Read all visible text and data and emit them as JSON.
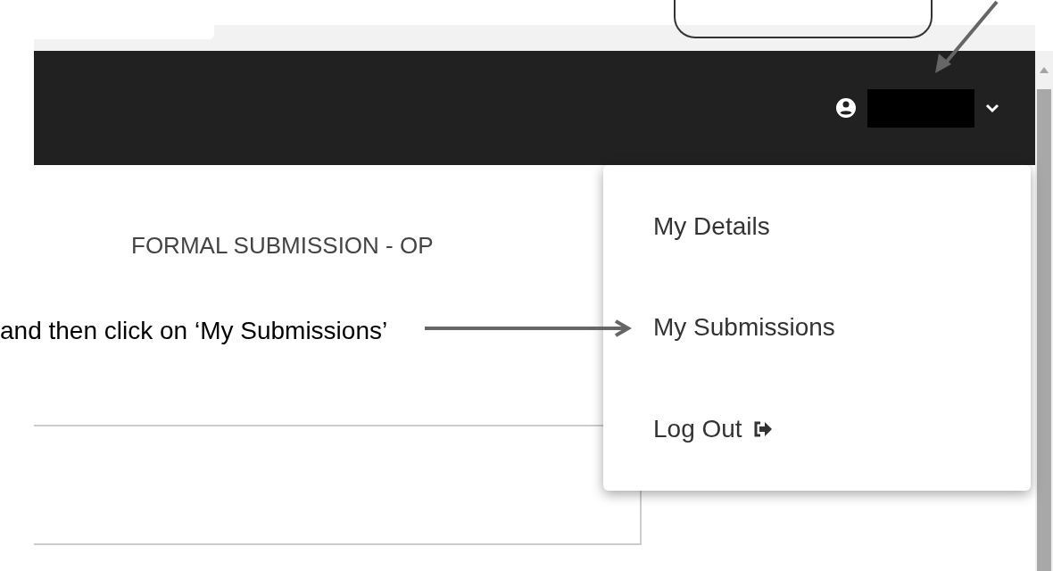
{
  "user_menu": {
    "expanded": true
  },
  "heading": "FORMAL SUBMISSION - OP",
  "menu": {
    "items": [
      {
        "label": "My Details",
        "kind": "link"
      },
      {
        "label": "My Submissions",
        "kind": "link"
      },
      {
        "label": "Log Out",
        "kind": "logout"
      }
    ]
  },
  "annotation": {
    "text": "and then click on ‘My Submissions’"
  }
}
